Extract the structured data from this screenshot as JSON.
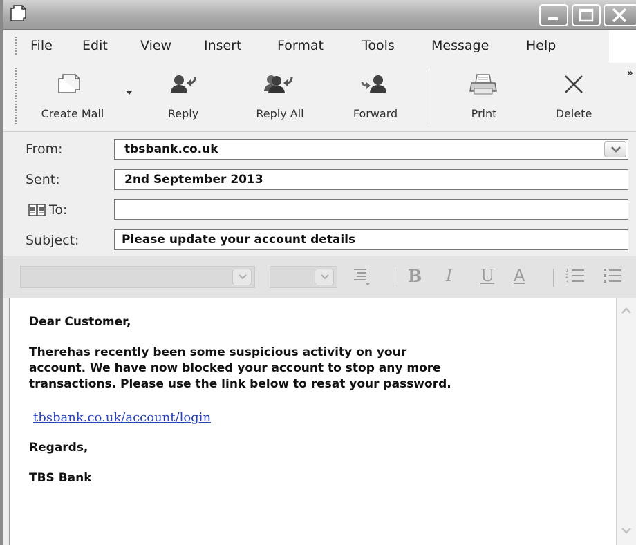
{
  "menu": [
    "File",
    "Edit",
    "View",
    "Insert",
    "Format",
    "Tools",
    "Message",
    "Help"
  ],
  "toolbar": {
    "create_mail": "Create Mail",
    "reply": "Reply",
    "reply_all": "Reply All",
    "forward": "Forward",
    "print": "Print",
    "delete": "Delete",
    "overflow": "»"
  },
  "headers": {
    "from_label": "From:",
    "from_value": "tbsbank.co.uk",
    "sent_label": "Sent:",
    "sent_value": "2nd September 2013",
    "to_label": "To:",
    "to_value": "",
    "subject_label": "Subject:",
    "subject_value": "Please update your account details"
  },
  "format_bar": {
    "bold": "B",
    "italic": "I",
    "underline": "U",
    "font_color": "A"
  },
  "message": {
    "greeting": "Dear Customer,",
    "paragraph_lines": [
      "Therehas recently been some suspicious activity on your",
      "account. We have now blocked your account to stop any more",
      "transactions. Please use the link below to resat your password."
    ],
    "link": "tbsbank.co.uk/account/login",
    "closing": "Regards,",
    "signature": "TBS Bank"
  },
  "colors": {
    "link": "#2743b8",
    "title_bar": "#a9a9a9",
    "toolbar_bg": "#f1f1f1"
  }
}
